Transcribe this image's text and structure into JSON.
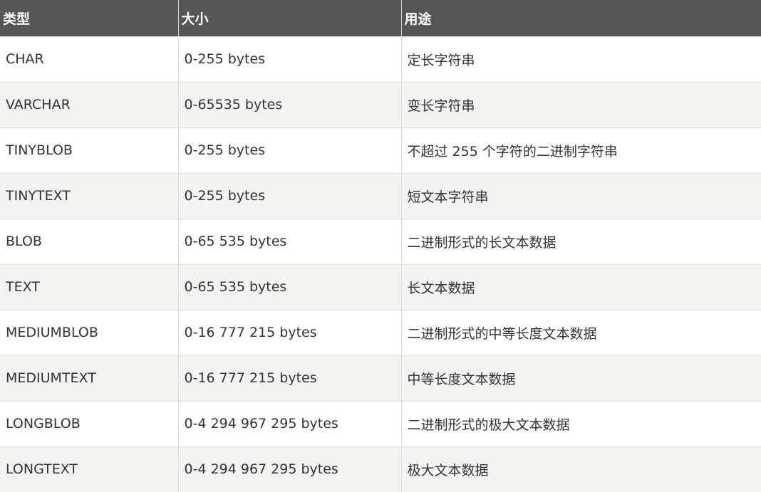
{
  "table": {
    "headers": [
      "类型",
      "大小",
      "用途"
    ],
    "rows": [
      [
        "CHAR",
        "0-255 bytes",
        "定长字符串"
      ],
      [
        "VARCHAR",
        "0-65535 bytes",
        "变长字符串"
      ],
      [
        "TINYBLOB",
        "0-255 bytes",
        "不超过 255 个字符的二进制字符串"
      ],
      [
        "TINYTEXT",
        "0-255 bytes",
        "短文本字符串"
      ],
      [
        "BLOB",
        "0-65 535 bytes",
        "二进制形式的长文本数据"
      ],
      [
        "TEXT",
        "0-65 535 bytes",
        "长文本数据"
      ],
      [
        "MEDIUMBLOB",
        "0-16 777 215 bytes",
        "二进制形式的中等长度文本数据"
      ],
      [
        "MEDIUMTEXT",
        "0-16 777 215 bytes",
        "中等长度文本数据"
      ],
      [
        "LONGBLOB",
        "0-4 294 967 295 bytes",
        "二进制形式的极大文本数据"
      ],
      [
        "LONGTEXT",
        "0-4 294 967 295 bytes",
        "极大文本数据"
      ]
    ]
  }
}
